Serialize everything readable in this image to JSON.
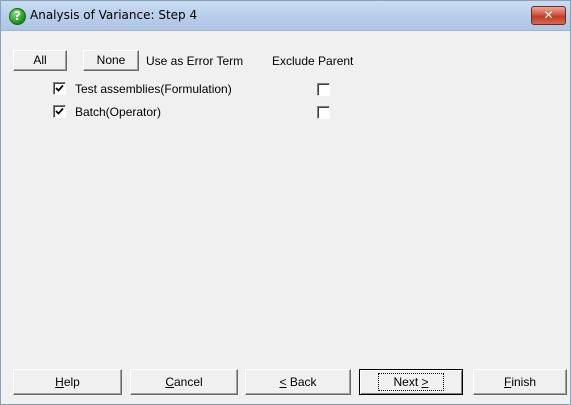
{
  "window": {
    "title": "Analysis of Variance: Step 4",
    "close_glyph": "✕"
  },
  "header": {
    "all_label": "All",
    "none_label": "None",
    "error_term_label": "Use as Error Term",
    "exclude_parent_label": "Exclude Parent"
  },
  "rows": [
    {
      "label": "Test assemblies(Formulation)",
      "use_as_error_term": true,
      "exclude_parent": false
    },
    {
      "label": "Batch(Operator)",
      "use_as_error_term": true,
      "exclude_parent": false
    }
  ],
  "footer": {
    "help": {
      "mnemonic": "H",
      "rest": "elp"
    },
    "cancel": {
      "mnemonic": "C",
      "rest": "ancel"
    },
    "back": {
      "mnemonic": "<",
      "rest": " Back"
    },
    "next": {
      "pre": "Next ",
      "mnemonic": ">"
    },
    "finish": {
      "mnemonic": "F",
      "rest": "inish"
    }
  },
  "icons": {
    "title_icon": "question-icon",
    "title_icon_glyph": "?"
  }
}
